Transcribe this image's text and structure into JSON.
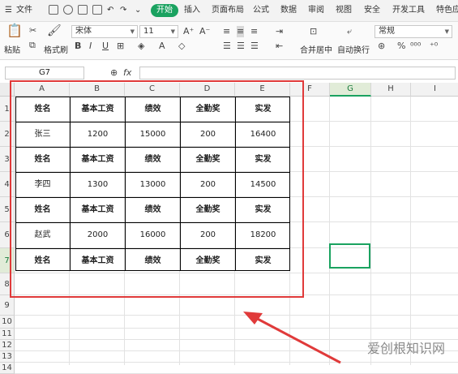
{
  "menubar": {
    "file_label": "文件",
    "tabs": [
      "开始",
      "插入",
      "页面布局",
      "公式",
      "数据",
      "审阅",
      "视图",
      "安全",
      "开发工具",
      "特色应"
    ],
    "active_tab": "开始"
  },
  "ribbon": {
    "paste": "粘贴",
    "format_painter": "格式刷",
    "font_name": "宋体",
    "font_size": "11",
    "merge_center": "合并居中",
    "wrap_text": "自动换行",
    "number_format": "常规"
  },
  "formula_bar": {
    "name_box": "G7",
    "fx": "fx",
    "value": ""
  },
  "columns": [
    "A",
    "B",
    "C",
    "D",
    "E",
    "F",
    "G",
    "H",
    "I"
  ],
  "rows": [
    "1",
    "2",
    "3",
    "4",
    "5",
    "6",
    "7",
    "8",
    "9",
    "10",
    "11",
    "12",
    "13",
    "14"
  ],
  "table": {
    "header": [
      "姓名",
      "基本工资",
      "绩效",
      "全勤奖",
      "实发"
    ],
    "records": [
      [
        "张三",
        "1200",
        "15000",
        "200",
        "16400"
      ],
      [
        "李四",
        "1300",
        "13000",
        "200",
        "14500"
      ],
      [
        "赵武",
        "2000",
        "16000",
        "200",
        "18200"
      ]
    ]
  },
  "selected_cell": "G7",
  "watermark": "爱创根知识网",
  "colors": {
    "accent": "#1aa260",
    "annotation": "#e03a3a"
  }
}
